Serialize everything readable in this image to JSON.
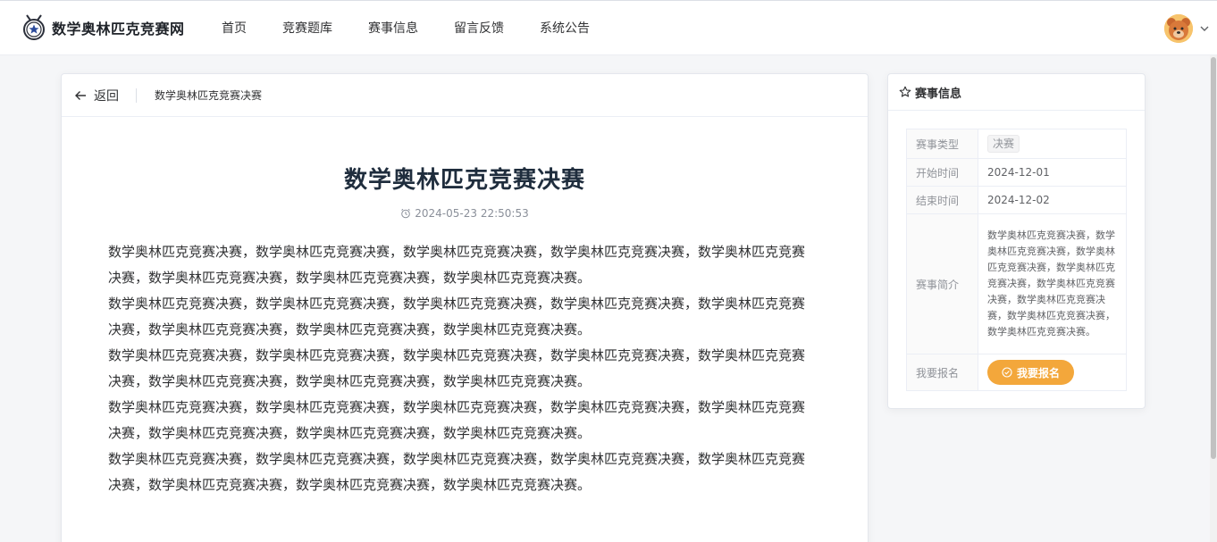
{
  "header": {
    "site_title": "数学奥林匹克竞赛网",
    "nav": [
      "首页",
      "竞赛题库",
      "赛事信息",
      "留言反馈",
      "系统公告"
    ]
  },
  "page_header": {
    "back_label": "返回",
    "content": "数学奥林匹克竞赛决赛"
  },
  "article": {
    "title": "数学奥林匹克竞赛决赛",
    "datetime": "2024-05-23 22:50:53",
    "paragraphs": [
      "数学奥林匹克竞赛决赛，数学奥林匹克竞赛决赛，数学奥林匹克竞赛决赛，数学奥林匹克竞赛决赛，数学奥林匹克竞赛决赛，数学奥林匹克竞赛决赛，数学奥林匹克竞赛决赛，数学奥林匹克竞赛决赛。",
      "数学奥林匹克竞赛决赛，数学奥林匹克竞赛决赛，数学奥林匹克竞赛决赛，数学奥林匹克竞赛决赛，数学奥林匹克竞赛决赛，数学奥林匹克竞赛决赛，数学奥林匹克竞赛决赛，数学奥林匹克竞赛决赛。",
      "数学奥林匹克竞赛决赛，数学奥林匹克竞赛决赛，数学奥林匹克竞赛决赛，数学奥林匹克竞赛决赛，数学奥林匹克竞赛决赛，数学奥林匹克竞赛决赛，数学奥林匹克竞赛决赛，数学奥林匹克竞赛决赛。",
      "数学奥林匹克竞赛决赛，数学奥林匹克竞赛决赛，数学奥林匹克竞赛决赛，数学奥林匹克竞赛决赛，数学奥林匹克竞赛决赛，数学奥林匹克竞赛决赛，数学奥林匹克竞赛决赛，数学奥林匹克竞赛决赛。",
      "数学奥林匹克竞赛决赛，数学奥林匹克竞赛决赛，数学奥林匹克竞赛决赛，数学奥林匹克竞赛决赛，数学奥林匹克竞赛决赛，数学奥林匹克竞赛决赛，数学奥林匹克竞赛决赛，数学奥林匹克竞赛决赛。"
    ]
  },
  "side": {
    "title": "赛事信息",
    "type_label": "赛事类型",
    "type_value": "决赛",
    "start_label": "开始时间",
    "start_value": "2024-12-01",
    "end_label": "结束时间",
    "end_value": "2024-12-02",
    "intro_label": "赛事简介",
    "intro_value": "数学奥林匹克竞赛决赛，数学奥林匹克竞赛决赛，数学奥林匹克竞赛决赛，数学奥林匹克竞赛决赛，数学奥林匹克竞赛决赛，数学奥林匹克竞赛决赛，数学奥林匹克竞赛决赛，数学奥林匹克竞赛决赛。",
    "signup_label": "我要报名",
    "signup_button": "我要报名"
  },
  "colors": {
    "accent": "#f3a73b",
    "title": "#1f2d3d",
    "muted": "#909399"
  },
  "icons": [
    "medal-logo-icon",
    "bear-avatar-icon",
    "chevron-down-icon",
    "arrow-left-icon",
    "alarm-clock-icon",
    "star-icon",
    "circle-check-icon"
  ]
}
